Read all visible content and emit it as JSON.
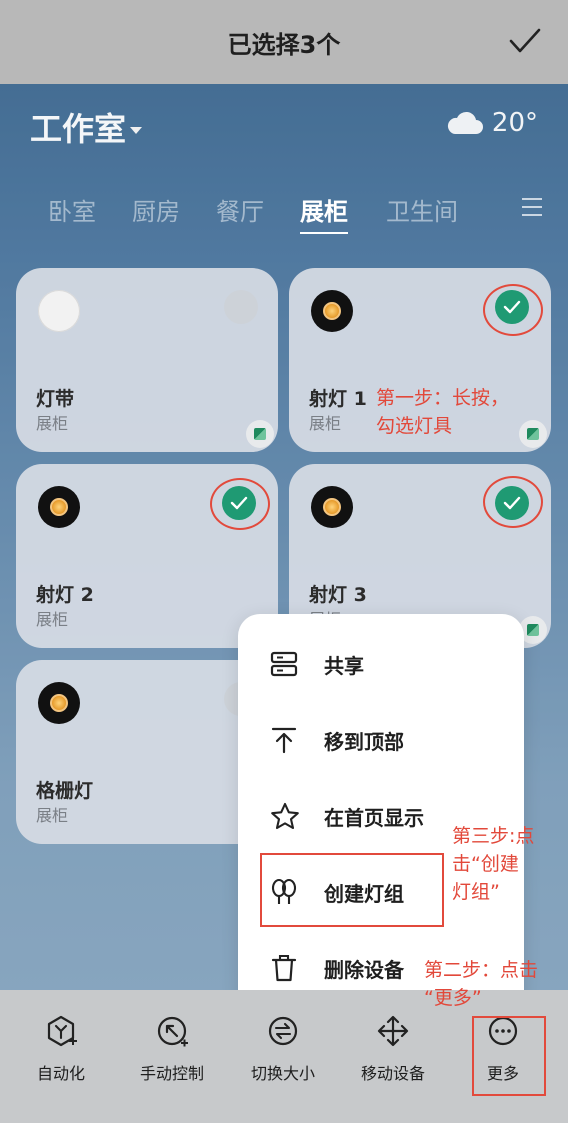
{
  "header": {
    "title": "已选择3个",
    "confirm_icon": "checkmark-icon"
  },
  "room": {
    "name": "工作室",
    "weather_icon": "cloud-icon",
    "temperature": "20°"
  },
  "tabs": [
    "卧室",
    "厨房",
    "餐厅",
    "展柜",
    "卫生间"
  ],
  "active_tab": "展柜",
  "devices": [
    {
      "name": "灯带",
      "room": "展柜",
      "selected": false
    },
    {
      "name": "射灯 1",
      "room": "展柜",
      "selected": true
    },
    {
      "name": "射灯 2",
      "room": "展柜",
      "selected": true
    },
    {
      "name": "射灯 3",
      "room": "展柜",
      "selected": true
    },
    {
      "name": "格栅灯",
      "room": "展柜",
      "selected": false
    }
  ],
  "menu": {
    "items": [
      {
        "label": "共享",
        "icon": "share-icon"
      },
      {
        "label": "移到顶部",
        "icon": "move-top-icon"
      },
      {
        "label": "在首页显示",
        "icon": "star-icon"
      },
      {
        "label": "创建灯组",
        "icon": "light-group-icon"
      },
      {
        "label": "删除设备",
        "icon": "trash-icon"
      }
    ]
  },
  "toolbar": {
    "items": [
      {
        "label": "自动化",
        "icon": "automation-icon"
      },
      {
        "label": "手动控制",
        "icon": "manual-control-icon"
      },
      {
        "label": "切换大小",
        "icon": "resize-icon"
      },
      {
        "label": "移动设备",
        "icon": "move-icon"
      },
      {
        "label": "更多",
        "icon": "more-icon"
      }
    ]
  },
  "annotations": {
    "step1": "第一步：长按，\n勾选灯具",
    "step2": "第二步：点击\n“更多”",
    "step3": "第三步:点\n击“创建\n灯组”"
  },
  "colors": {
    "accent": "#1f9a73",
    "annotation": "#e2483a"
  }
}
